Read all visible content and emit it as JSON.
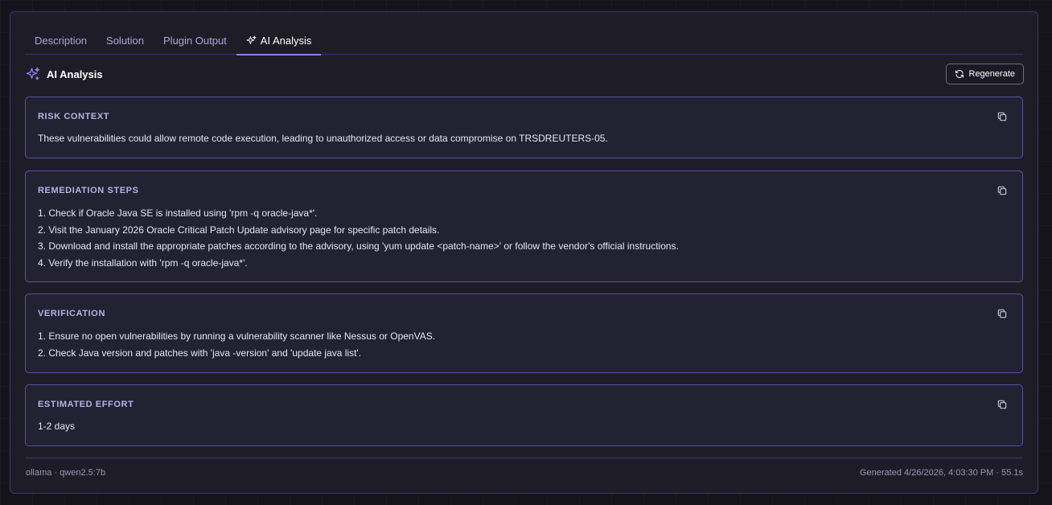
{
  "tabs": [
    {
      "label": "Description"
    },
    {
      "label": "Solution"
    },
    {
      "label": "Plugin Output"
    },
    {
      "label": "AI Analysis",
      "active": true
    }
  ],
  "header": {
    "title": "AI Analysis",
    "regenerate_label": "Regenerate"
  },
  "sections": {
    "risk": {
      "label": "RISK CONTEXT",
      "lines": [
        "These vulnerabilities could allow remote code execution, leading to unauthorized access or data compromise on TRSDREUTERS-05."
      ]
    },
    "remediation": {
      "label": "REMEDIATION STEPS",
      "lines": [
        "1. Check if Oracle Java SE is installed using 'rpm -q oracle-java*'.",
        "2. Visit the January 2026 Oracle Critical Patch Update advisory page for specific patch details.",
        "3. Download and install the appropriate patches according to the advisory, using 'yum update <patch-name>' or follow the vendor's official instructions.",
        "4. Verify the installation with 'rpm -q oracle-java*'."
      ]
    },
    "verification": {
      "label": "VERIFICATION",
      "lines": [
        "1. Ensure no open vulnerabilities by running a vulnerability scanner like Nessus or OpenVAS.",
        "2. Check Java version and patches with 'java -version' and 'update java list'."
      ]
    },
    "effort": {
      "label": "ESTIMATED EFFORT",
      "lines": [
        "1-2 days"
      ]
    }
  },
  "footer": {
    "model": "ollama · qwen2.5:7b",
    "generated": "Generated 4/26/2026, 4:03:30 PM · 55.1s"
  },
  "icons": {
    "sparkle": "sparkle-icon",
    "refresh": "refresh-icon",
    "copy": "copy-icon"
  },
  "colors": {
    "accent": "#8e80e8",
    "card_border": "#5b4f9c",
    "background": "#15141c"
  }
}
